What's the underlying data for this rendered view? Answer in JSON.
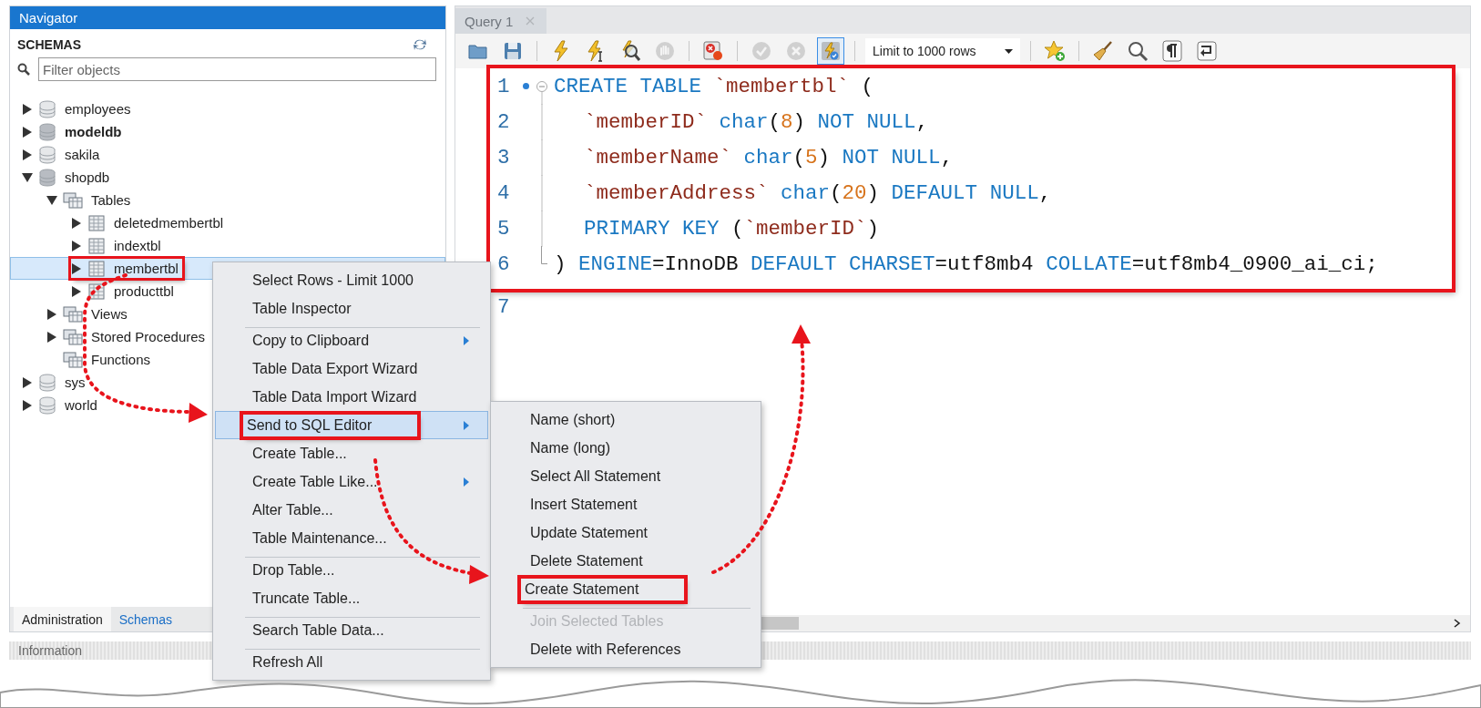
{
  "navigator": {
    "title": "Navigator",
    "section": "SCHEMAS",
    "filter": {
      "placeholder": "Filter objects"
    },
    "tree": [
      {
        "label": "employees",
        "kind": "schema",
        "leaf": false,
        "expanded": false,
        "bold": false,
        "selected": false,
        "framed": false
      },
      {
        "label": "modeldb",
        "kind": "schema",
        "leaf": false,
        "expanded": false,
        "bold": true,
        "selected": false,
        "framed": false
      },
      {
        "label": "sakila",
        "kind": "schema",
        "leaf": false,
        "expanded": false,
        "bold": false,
        "selected": false,
        "framed": false
      },
      {
        "label": "shopdb",
        "kind": "schema",
        "leaf": false,
        "expanded": true,
        "bold": false,
        "selected": false,
        "framed": false,
        "children": [
          {
            "label": "Tables",
            "kind": "folder",
            "leaf": false,
            "expanded": true,
            "bold": false,
            "selected": false,
            "framed": false,
            "children": [
              {
                "label": "deletedmembertbl",
                "kind": "table",
                "leaf": false,
                "expanded": false,
                "bold": false,
                "selected": false,
                "framed": false
              },
              {
                "label": "indextbl",
                "kind": "table",
                "leaf": false,
                "expanded": false,
                "bold": false,
                "selected": false,
                "framed": false
              },
              {
                "label": "membertbl",
                "kind": "table",
                "leaf": false,
                "expanded": false,
                "bold": false,
                "selected": true,
                "framed": true
              },
              {
                "label": "producttbl",
                "kind": "table",
                "leaf": false,
                "expanded": false,
                "bold": false,
                "selected": false,
                "framed": false
              }
            ]
          },
          {
            "label": "Views",
            "kind": "folder",
            "leaf": false,
            "expanded": false,
            "bold": false,
            "selected": false,
            "framed": false
          },
          {
            "label": "Stored Procedures",
            "kind": "folder",
            "leaf": false,
            "expanded": false,
            "bold": false,
            "selected": false,
            "framed": false
          },
          {
            "label": "Functions",
            "kind": "folder",
            "leaf": true,
            "bold": false,
            "selected": false,
            "framed": false
          }
        ]
      },
      {
        "label": "sys",
        "kind": "schema",
        "leaf": false,
        "expanded": false,
        "bold": false,
        "selected": false,
        "framed": false
      },
      {
        "label": "world",
        "kind": "schema",
        "leaf": false,
        "expanded": false,
        "bold": false,
        "selected": false,
        "framed": false
      }
    ],
    "bottom_tabs": [
      {
        "label": "Administration",
        "selected": false
      },
      {
        "label": "Schemas",
        "selected": true
      }
    ],
    "info_title": "Information"
  },
  "editor": {
    "tab": {
      "label": "Query 1"
    },
    "toolbar": [
      [
        {
          "kind": "open",
          "disabled": false,
          "on": false
        },
        {
          "kind": "save",
          "disabled": false,
          "on": false
        }
      ],
      [
        {
          "kind": "execute",
          "disabled": false,
          "on": false
        },
        {
          "kind": "execute-current",
          "disabled": false,
          "on": false
        },
        {
          "kind": "explain",
          "disabled": false,
          "on": false
        },
        {
          "kind": "stop",
          "disabled": true,
          "on": false
        }
      ],
      [
        {
          "kind": "stop-on-error",
          "disabled": false,
          "on": false
        }
      ],
      [
        {
          "kind": "commit",
          "disabled": true,
          "on": false
        },
        {
          "kind": "rollback",
          "disabled": true,
          "on": false
        },
        {
          "kind": "autocommit",
          "disabled": false,
          "on": true
        }
      ],
      [
        {
          "kind": "select",
          "value": "Limit to 1000 rows"
        }
      ],
      [
        {
          "kind": "snippet",
          "disabled": false,
          "on": false
        }
      ],
      [
        {
          "kind": "beautify",
          "disabled": false,
          "on": false
        },
        {
          "kind": "find",
          "disabled": false,
          "on": false
        },
        {
          "kind": "invisible",
          "disabled": false,
          "on": false
        },
        {
          "kind": "wrap",
          "disabled": false,
          "on": false
        }
      ]
    ],
    "lines": [
      {
        "number": "1",
        "current": true,
        "fold_open": true,
        "in_fold": false,
        "fold_close": false,
        "indented": false,
        "framed": true,
        "tokens": [
          {
            "kind": "keyword",
            "text": "CREATE TABLE "
          },
          {
            "kind": "ident",
            "text": "`membertbl`"
          },
          {
            "kind": "plain",
            "text": " ("
          }
        ]
      },
      {
        "number": "2",
        "current": false,
        "fold_open": false,
        "in_fold": true,
        "fold_close": false,
        "indented": true,
        "framed": true,
        "tokens": [
          {
            "kind": "ident",
            "text": "`memberID`"
          },
          {
            "kind": "keyword",
            "text": " char"
          },
          {
            "kind": "plain",
            "text": "("
          },
          {
            "kind": "number",
            "text": "8"
          },
          {
            "kind": "plain",
            "text": ") "
          },
          {
            "kind": "keyword",
            "text": "NOT NULL"
          },
          {
            "kind": "plain",
            "text": ","
          }
        ]
      },
      {
        "number": "3",
        "current": false,
        "fold_open": false,
        "in_fold": true,
        "fold_close": false,
        "indented": true,
        "framed": true,
        "tokens": [
          {
            "kind": "ident",
            "text": "`memberName`"
          },
          {
            "kind": "keyword",
            "text": " char"
          },
          {
            "kind": "plain",
            "text": "("
          },
          {
            "kind": "number",
            "text": "5"
          },
          {
            "kind": "plain",
            "text": ") "
          },
          {
            "kind": "keyword",
            "text": "NOT NULL"
          },
          {
            "kind": "plain",
            "text": ","
          }
        ]
      },
      {
        "number": "4",
        "current": false,
        "fold_open": false,
        "in_fold": true,
        "fold_close": false,
        "indented": true,
        "framed": true,
        "tokens": [
          {
            "kind": "ident",
            "text": "`memberAddress`"
          },
          {
            "kind": "keyword",
            "text": " char"
          },
          {
            "kind": "plain",
            "text": "("
          },
          {
            "kind": "number",
            "text": "20"
          },
          {
            "kind": "plain",
            "text": ") "
          },
          {
            "kind": "keyword",
            "text": "DEFAULT NULL"
          },
          {
            "kind": "plain",
            "text": ","
          }
        ]
      },
      {
        "number": "5",
        "current": false,
        "fold_open": false,
        "in_fold": true,
        "fold_close": false,
        "indented": true,
        "framed": true,
        "tokens": [
          {
            "kind": "keyword",
            "text": "PRIMARY KEY"
          },
          {
            "kind": "plain",
            "text": " ("
          },
          {
            "kind": "ident",
            "text": "`memberID`"
          },
          {
            "kind": "plain",
            "text": ")"
          }
        ]
      },
      {
        "number": "6",
        "current": false,
        "fold_open": false,
        "in_fold": false,
        "fold_close": true,
        "indented": false,
        "framed": true,
        "tokens": [
          {
            "kind": "plain",
            "text": ") "
          },
          {
            "kind": "keyword",
            "text": "ENGINE"
          },
          {
            "kind": "plain",
            "text": "=InnoDB "
          },
          {
            "kind": "keyword",
            "text": "DEFAULT CHARSET"
          },
          {
            "kind": "plain",
            "text": "=utf8mb4 "
          },
          {
            "kind": "keyword",
            "text": "COLLATE"
          },
          {
            "kind": "plain",
            "text": "=utf8mb4_0900_ai_ci;"
          }
        ]
      },
      {
        "number": "7",
        "current": false,
        "fold_open": false,
        "in_fold": false,
        "fold_close": false,
        "framed": false
      }
    ]
  },
  "context_menu": {
    "items": [
      {
        "label": "Select Rows - Limit 1000",
        "submenu": false,
        "highlighted": false,
        "framed": false,
        "separator_before": false
      },
      {
        "label": "Table Inspector",
        "submenu": false,
        "highlighted": false,
        "framed": false,
        "separator_before": false
      },
      {
        "label": "Copy to Clipboard",
        "submenu": true,
        "highlighted": false,
        "framed": false,
        "separator_before": true
      },
      {
        "label": "Table Data Export Wizard",
        "submenu": false,
        "highlighted": false,
        "framed": false,
        "separator_before": false
      },
      {
        "label": "Table Data Import Wizard",
        "submenu": false,
        "highlighted": false,
        "framed": false,
        "separator_before": false
      },
      {
        "label": "Send to SQL Editor",
        "submenu": true,
        "highlighted": true,
        "framed": true,
        "separator_before": false
      },
      {
        "label": "Create Table...",
        "submenu": false,
        "highlighted": false,
        "framed": false,
        "separator_before": false
      },
      {
        "label": "Create Table Like...",
        "submenu": true,
        "highlighted": false,
        "framed": false,
        "separator_before": false
      },
      {
        "label": "Alter Table...",
        "submenu": false,
        "highlighted": false,
        "framed": false,
        "separator_before": false
      },
      {
        "label": "Table Maintenance...",
        "submenu": false,
        "highlighted": false,
        "framed": false,
        "separator_before": false
      },
      {
        "label": "Drop Table...",
        "submenu": false,
        "highlighted": false,
        "framed": false,
        "separator_before": true
      },
      {
        "label": "Truncate Table...",
        "submenu": false,
        "highlighted": false,
        "framed": false,
        "separator_before": false
      },
      {
        "label": "Search Table Data...",
        "submenu": false,
        "highlighted": false,
        "framed": false,
        "separator_before": true
      },
      {
        "label": "Refresh All",
        "submenu": false,
        "highlighted": false,
        "framed": false,
        "separator_before": true
      }
    ]
  },
  "submenu": {
    "items": [
      {
        "label": "Name (short)",
        "disabled": false,
        "framed": false,
        "separator_before": false
      },
      {
        "label": "Name (long)",
        "disabled": false,
        "framed": false,
        "separator_before": false
      },
      {
        "label": "Select All Statement",
        "disabled": false,
        "framed": false,
        "separator_before": false
      },
      {
        "label": "Insert Statement",
        "disabled": false,
        "framed": false,
        "separator_before": false
      },
      {
        "label": "Update Statement",
        "disabled": false,
        "framed": false,
        "separator_before": false
      },
      {
        "label": "Delete Statement",
        "disabled": false,
        "framed": false,
        "separator_before": false
      },
      {
        "label": "Create Statement",
        "disabled": false,
        "framed": true,
        "separator_before": false
      },
      {
        "label": "Join Selected Tables",
        "disabled": true,
        "framed": false,
        "separator_before": true
      },
      {
        "label": "Delete with References",
        "disabled": false,
        "framed": false,
        "separator_before": false
      }
    ]
  }
}
